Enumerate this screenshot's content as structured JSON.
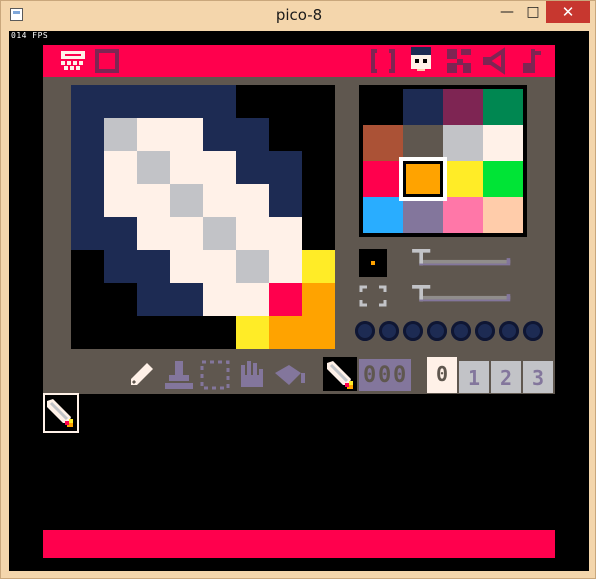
{
  "window": {
    "title": "pico-8",
    "minimize_label": "—",
    "maximize_label": "□",
    "close_label": "✕"
  },
  "overlay": {
    "fps": "014 FPS"
  },
  "top_bar": {
    "left_icons": [
      "pico8-logo-icon",
      "sprite-square-icon"
    ],
    "right_tabs": [
      "code-editor-icon",
      "sprite-editor-icon",
      "map-editor-icon",
      "sfx-editor-icon",
      "music-editor-icon"
    ],
    "active_tab": "sprite-editor-icon"
  },
  "palette": {
    "colors": [
      "#000000",
      "#1d2b53",
      "#7e2553",
      "#008751",
      "#ab5236",
      "#5f574f",
      "#c2c3c7",
      "#fff1e8",
      "#ff004d",
      "#ffa300",
      "#ffec27",
      "#00e436",
      "#29adff",
      "#83769c",
      "#ff77a8",
      "#ffccaa"
    ],
    "selected_index": 9
  },
  "sprite_grid": {
    "size": 8,
    "pixels": [
      [
        1,
        1,
        1,
        1,
        1,
        0,
        0,
        0
      ],
      [
        1,
        6,
        7,
        7,
        1,
        1,
        0,
        0
      ],
      [
        1,
        7,
        6,
        7,
        7,
        1,
        1,
        0
      ],
      [
        1,
        7,
        7,
        6,
        7,
        7,
        1,
        0
      ],
      [
        1,
        1,
        7,
        7,
        6,
        7,
        7,
        0
      ],
      [
        0,
        1,
        1,
        7,
        7,
        6,
        7,
        10
      ],
      [
        0,
        0,
        1,
        1,
        7,
        7,
        8,
        9
      ],
      [
        0,
        0,
        0,
        0,
        0,
        10,
        9,
        9
      ]
    ]
  },
  "flags": {
    "count": 8
  },
  "tools": [
    "pencil-icon",
    "stamp-icon",
    "select-icon",
    "hand-icon",
    "fill-icon"
  ],
  "sprite_number": {
    "digits": [
      "0",
      "0",
      "0"
    ]
  },
  "sprite_tabs": [
    {
      "label": "0",
      "active": true
    },
    {
      "label": "1",
      "active": false
    },
    {
      "label": "2",
      "active": false
    },
    {
      "label": "3",
      "active": false
    }
  ]
}
